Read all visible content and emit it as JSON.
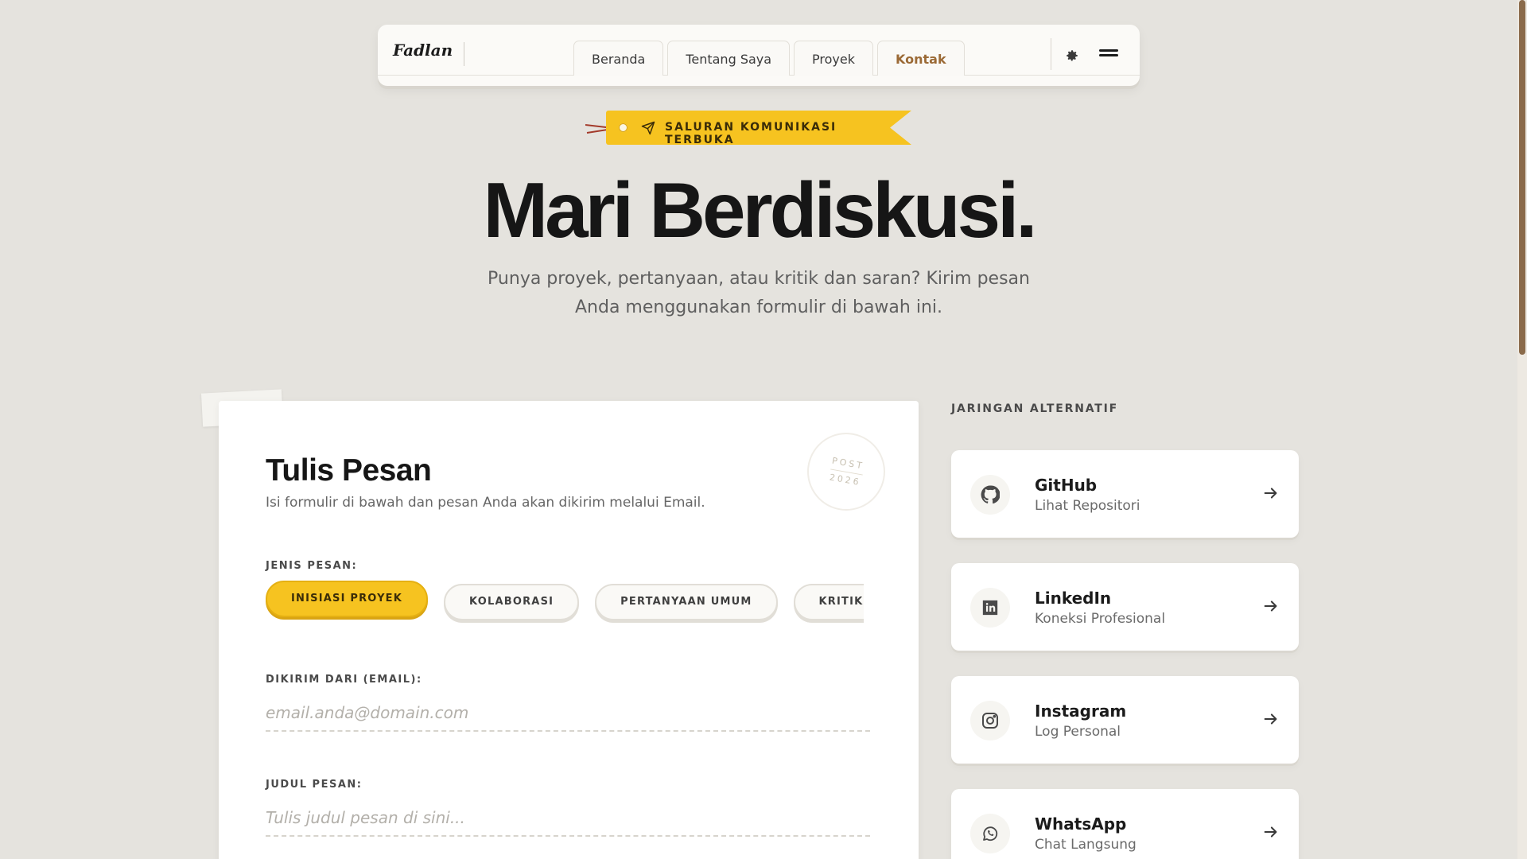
{
  "nav": {
    "brand": "Fadlan",
    "tabs": [
      {
        "label": "Beranda"
      },
      {
        "label": "Tentang Saya"
      },
      {
        "label": "Proyek"
      },
      {
        "label": "Kontak"
      }
    ],
    "active_tab": "Kontak"
  },
  "hero": {
    "badge": "SALURAN KOMUNIKASI TERBUKA",
    "title": "Mari Berdiskusi.",
    "subtitle": "Punya proyek, pertanyaan, atau kritik dan saran? Kirim pesan Anda menggunakan formulir di bawah ini."
  },
  "form": {
    "title": "Tulis Pesan",
    "subtitle": "Isi formulir di bawah dan pesan Anda akan dikirim melalui Email.",
    "stamp_top": "POST",
    "stamp_bottom": "2026",
    "type_label": "JENIS PESAN:",
    "types": [
      {
        "label": "INISIASI PROYEK"
      },
      {
        "label": "KOLABORASI"
      },
      {
        "label": "PERTANYAAN UMUM"
      },
      {
        "label": "KRITIK & SARAN"
      }
    ],
    "selected_type": "INISIASI PROYEK",
    "email_label": "DIKIRIM DARI (EMAIL):",
    "email_placeholder": "email.anda@domain.com",
    "subject_label": "JUDUL PESAN:",
    "subject_placeholder": "Tulis judul pesan di sini..."
  },
  "networks": {
    "title": "JARINGAN ALTERNATIF",
    "items": [
      {
        "name": "GitHub",
        "desc": "Lihat Repositori",
        "icon": "github-icon"
      },
      {
        "name": "LinkedIn",
        "desc": "Koneksi Profesional",
        "icon": "linkedin-icon"
      },
      {
        "name": "Instagram",
        "desc": "Log Personal",
        "icon": "instagram-icon"
      },
      {
        "name": "WhatsApp",
        "desc": "Chat Langsung",
        "icon": "whatsapp-icon"
      }
    ]
  },
  "colors": {
    "accent": "#f6c320",
    "active_tab": "#9b6a36",
    "background": "#e5e3de"
  }
}
